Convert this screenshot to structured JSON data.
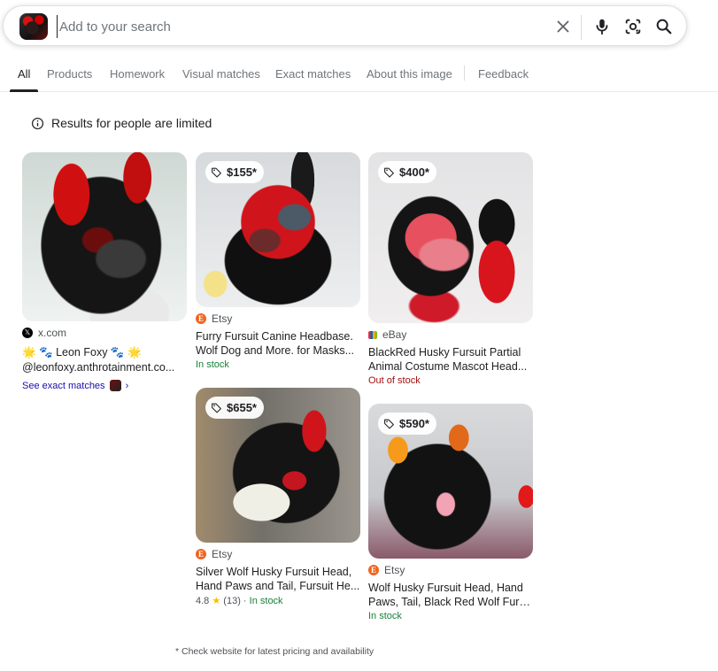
{
  "search": {
    "placeholder": "Add to your search",
    "value": ""
  },
  "tabs": [
    {
      "label": "All",
      "active": true
    },
    {
      "label": "Products"
    },
    {
      "label": "Homework"
    },
    {
      "label": "Visual matches"
    },
    {
      "label": "Exact matches"
    },
    {
      "label": "About this image"
    },
    {
      "label": "Feedback"
    }
  ],
  "notice": "Results for people are limited",
  "results": [
    {
      "source": "x.com",
      "title": "🌟 🐾 Leon Foxy 🐾 🌟",
      "subtitle": "@leonfoxy.anthrotainment.co...",
      "link": "See exact matches"
    },
    {
      "price": "$155*",
      "source": "Etsy",
      "title": "Furry Fursuit Canine Headbase.",
      "subtitle": "Wolf Dog and More. for Masks...",
      "stock": "In stock"
    },
    {
      "price": "$400*",
      "source": "eBay",
      "title": "BlackRed Husky Fursuit Partial",
      "subtitle": "Animal Costume Mascot Head...",
      "stock": "Out of stock"
    },
    {
      "price": "$655*",
      "source": "Etsy",
      "title": "Silver Wolf Husky Fursuit Head,",
      "subtitle": "Hand Paws and Tail, Fursuit He...",
      "rating": "4.8",
      "star": "★",
      "reviews": "(13)",
      "sep": "·",
      "stock": "In stock"
    },
    {
      "price": "$590*",
      "source": "Etsy",
      "title": "Wolf Husky Fursuit Head, Hand",
      "subtitle": "Paws, Tail, Black Red Wolf Furs...",
      "stock": "In stock"
    }
  ],
  "footnote": "* Check website for latest pricing and availability",
  "colors": {
    "in_stock": "#188038",
    "out_of_stock": "#a50e0e",
    "link": "#1a0dab",
    "etsy": "#f1641e"
  },
  "icons": [
    "clear-icon",
    "microphone-icon",
    "lens-icon",
    "search-icon",
    "info-icon",
    "price-tag-icon"
  ]
}
